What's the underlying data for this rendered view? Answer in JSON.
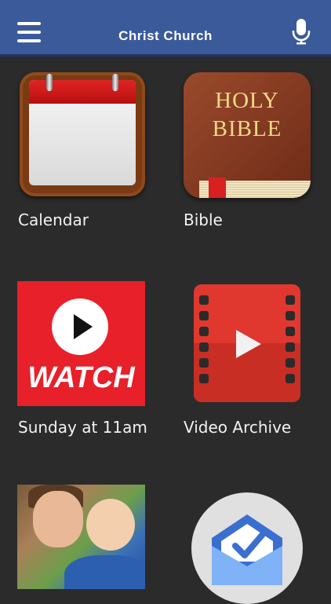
{
  "header": {
    "title": "Christ Church",
    "menu_icon": "hamburger-icon",
    "mic_icon": "microphone-icon"
  },
  "tiles": [
    {
      "label": "Calendar",
      "icon": "calendar-icon"
    },
    {
      "label": "Bible",
      "icon": "bible-icon",
      "icon_text": [
        "HOLY",
        "BIBLE"
      ]
    },
    {
      "label": "Sunday at 11am",
      "icon": "watch-icon",
      "icon_text": "WATCH"
    },
    {
      "label": "Video Archive",
      "icon": "video-archive-icon"
    },
    {
      "label": "",
      "icon": "family-photo-icon"
    },
    {
      "label": "",
      "icon": "inbox-icon"
    }
  ],
  "colors": {
    "header": "#3b5a9a",
    "background": "#2b2b2b",
    "watch_red": "#e8202a",
    "video_red": "#e0382e",
    "inbox_blue": "#4285f4"
  }
}
